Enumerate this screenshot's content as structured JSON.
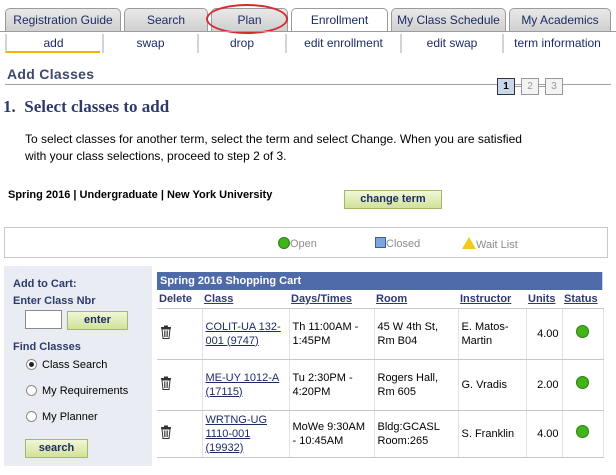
{
  "top_tabs": {
    "registration_guide": "Registration Guide",
    "search": "Search",
    "plan": "Plan",
    "enrollment": "Enrollment",
    "my_class_schedule": "My Class Schedule",
    "my_academics": "My Academics"
  },
  "sub_tabs": {
    "add": "add",
    "swap": "swap",
    "drop": "drop",
    "edit_enrollment": "edit enrollment",
    "edit_swap": "edit swap",
    "term_information": "term information"
  },
  "page": {
    "title": "Add Classes",
    "steps": [
      "1",
      "2",
      "3"
    ],
    "step_title": "1.  Select classes to add",
    "instructions": "To select classes for another term, select the term and select Change.  When you are satisfied with your class selections, proceed to step 2 of 3.",
    "term_info": "Spring 2016 | Undergraduate | New York University",
    "change_term_button": "change term"
  },
  "legend": {
    "open": "Open",
    "closed": "Closed",
    "wait_list": "Wait List"
  },
  "add_to_cart": {
    "heading": "Add to Cart:",
    "enter_class_nbr": "Enter Class Nbr",
    "class_nbr_value": "",
    "enter_button": "enter",
    "find_classes": "Find Classes",
    "options": {
      "class_search": "Class Search",
      "my_requirements": "My Requirements",
      "my_planner": "My Planner"
    },
    "selected_option": "Class Search",
    "search_button": "search"
  },
  "cart": {
    "title": "Spring 2016 Shopping Cart",
    "headers": {
      "delete": "Delete",
      "class": "Class",
      "days_times": "Days/Times",
      "room": "Room",
      "instructor": "Instructor",
      "units": "Units",
      "status": "Status"
    },
    "rows": [
      {
        "class": "COLIT-UA 132-001 (9747)",
        "days_times": "Th 11:00AM - 1:45PM",
        "room": "45 W 4th St, Rm B04",
        "instructor": "E. Matos-Martin",
        "units": "4.00",
        "status": "Open"
      },
      {
        "class": "ME-UY 1012-A (17115)",
        "days_times": "Tu 2:30PM - 4:20PM",
        "room": "Rogers Hall, Rm 605",
        "instructor": "G. Vradis",
        "units": "2.00",
        "status": "Open"
      },
      {
        "class": "WRTNG-UG 1110-001 (19932)",
        "days_times": "MoWe 9:30AM - 10:45AM",
        "room": "Bldg:GCASL Room:265",
        "instructor": "S. Franklin",
        "units": "4.00",
        "status": "Open"
      }
    ]
  },
  "colors": {
    "tab_text": "#1b2c66",
    "cart_header_bg": "#4f6aa8",
    "open_green": "#40b418",
    "closed_blue": "#7aa6dc",
    "wait_yellow": "#f2c81a",
    "highlight_ring": "#d42d2d",
    "button_bg": "#d1e198"
  },
  "icons": {
    "delete": "trash-icon",
    "open": "green-circle-icon",
    "closed": "blue-square-icon",
    "wait_list": "yellow-triangle-icon"
  }
}
